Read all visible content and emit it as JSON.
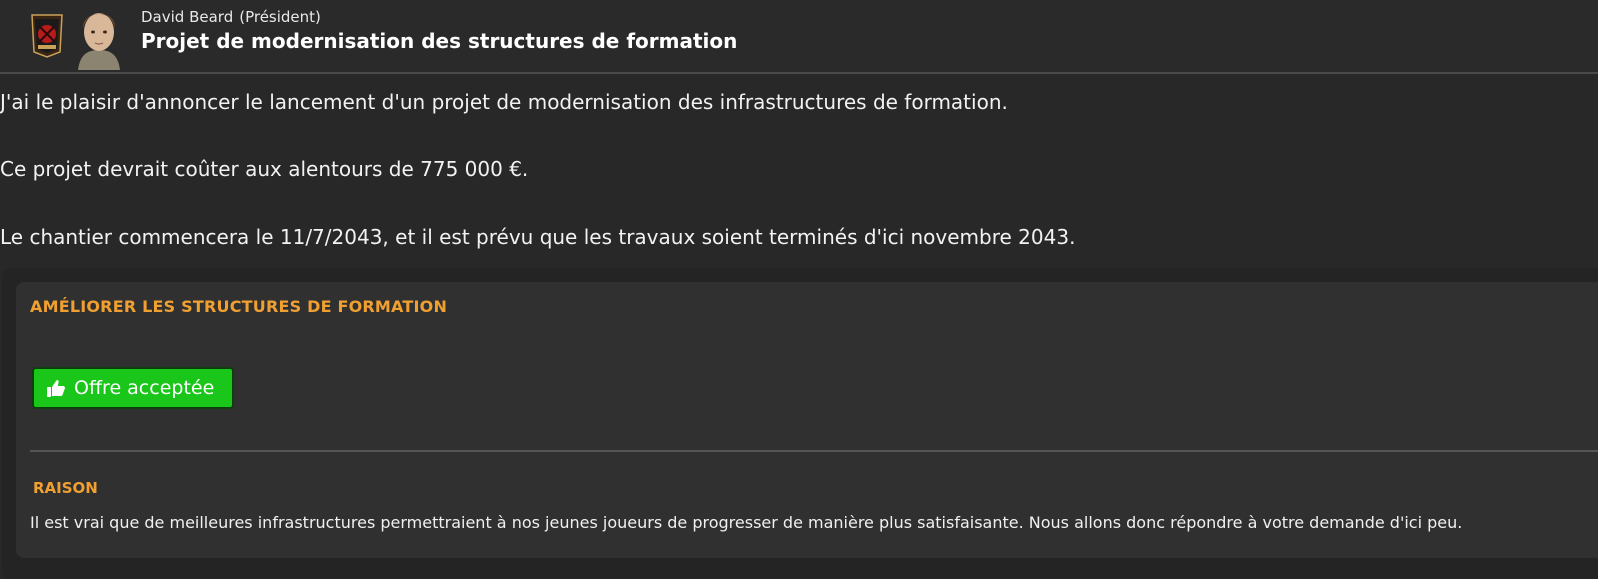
{
  "header": {
    "sender_name": "David Beard",
    "sender_role": "(Président)",
    "subject": "Projet de modernisation des structures de formation"
  },
  "body": {
    "paragraphs": [
      "J'ai le plaisir d'annoncer le lancement d'un projet de modernisation des infrastructures de formation.",
      "Ce projet devrait coûter aux alentours de 775 000 €.",
      "Le chantier commencera le 11/7/2043, et il est prévu que les travaux soient terminés d'ici novembre 2043."
    ]
  },
  "card": {
    "title": "AMÉLIORER LES STRUCTURES DE FORMATION",
    "status_button": {
      "label": "Offre acceptée",
      "icon": "thumbs-up-icon",
      "color": "#19c619"
    },
    "reason_title": "RAISON",
    "reason_text": "Il est vrai que de meilleures infrastructures permettraient à nos jeunes joueurs de progresser de manière plus satisfaisante. Nous allons donc répondre à votre demande d'ici peu."
  },
  "colors": {
    "background": "#282828",
    "accent": "#f0a030",
    "success": "#19c619"
  }
}
